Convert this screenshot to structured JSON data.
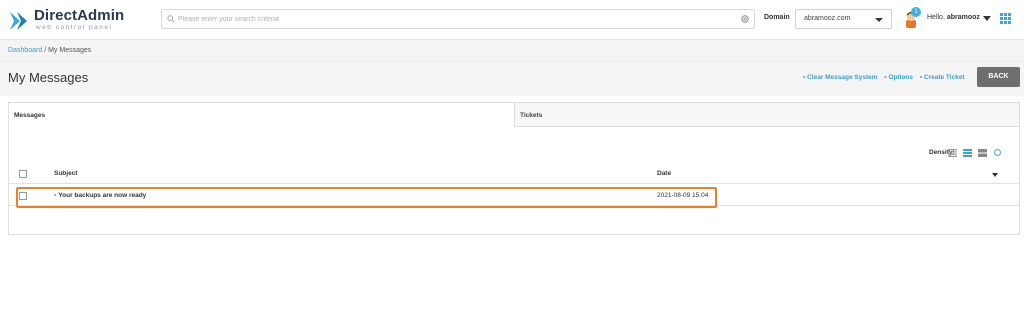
{
  "header": {
    "logo_title": "DirectAdmin",
    "logo_subtitle": "web control panel",
    "search_placeholder": "Please enter your search criteria",
    "domain_label": "Domain",
    "domain_value": "abramooz.com",
    "notification_count": "1",
    "hello_prefix": "Hello,",
    "username": "abramooz",
    "accent_color": "#3a9fd6"
  },
  "breadcrumb": {
    "home": "Dashboard",
    "separator": " / ",
    "current": "My Messages"
  },
  "page": {
    "title": "My Messages",
    "links": [
      "• Clear Message System",
      "• Options",
      "• Create Ticket"
    ],
    "back_label": "BACK"
  },
  "tabs": [
    {
      "label": "Messages",
      "active": true
    },
    {
      "label": "Tickets",
      "active": false
    }
  ],
  "density": {
    "label": "Density:",
    "options": [
      "compact-icon",
      "normal-icon",
      "comfortable-icon"
    ],
    "selected": "normal-icon"
  },
  "table": {
    "columns": [
      "Subject",
      "Date"
    ],
    "rows": [
      {
        "subject": "Your backups are now ready",
        "date": "2021-08-09 15:04",
        "unread": true
      }
    ],
    "highlight_color": "#f07c24"
  }
}
